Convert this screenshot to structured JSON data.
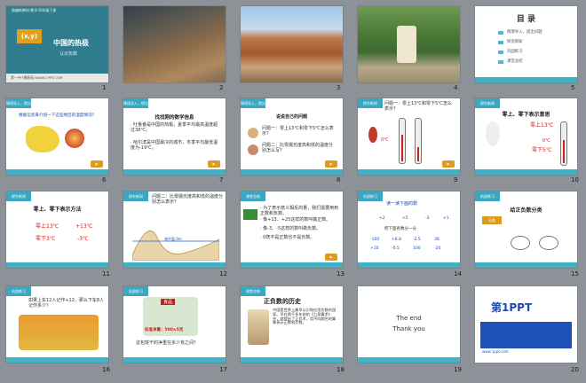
{
  "slides": [
    {
      "number": "1",
      "kicker": "统编新教材·数学·四年级下册",
      "badge": "(x,y)",
      "title": "中国的热极",
      "subtitle": "认识负数",
      "footer": "第一PPT模板网-WWW.1PPT.COM"
    },
    {
      "number": "2"
    },
    {
      "number": "3"
    },
    {
      "number": "4"
    },
    {
      "number": "5",
      "title": "目 录",
      "items": [
        "情境导入，提出问题",
        "探究新知",
        "巩固练习",
        "课堂总结"
      ]
    },
    {
      "number": "6",
      "tag": "情境导入，提出问题",
      "caption": "根据信息来介绍一下这些地区的温度情况？"
    },
    {
      "number": "7",
      "tag": "情境导入，提出问题",
      "title": "找找刚的数学信息",
      "lines": [
        "· 吐鲁番是中国的热极，夏季平均最高温度超过38℃。",
        "· 哈尔滨是中国最冷的城市，冬季平均最低温度为-19℃。"
      ]
    },
    {
      "number": "8",
      "tag": "情境导入，提出问题",
      "title": "说说自己的问题",
      "lines": [
        "问题一：零上13℃和零下5℃怎么表示？",
        "问题二：比零摄氏度高和低的温度分别怎么写？"
      ]
    },
    {
      "number": "9",
      "tag": "探究新知",
      "question": "问题一：零上13℃和零下5℃怎么表示？",
      "label": "0℃"
    },
    {
      "number": "10",
      "tag": "探究新知",
      "title": "零上、零下表示意思",
      "label1": "零上13℃",
      "label2": "0℃",
      "label3": "零下5℃"
    },
    {
      "number": "11",
      "tag": "探究新知",
      "title": "零上、零下表示方法",
      "line1a": "零上13℃",
      "line1b": "+13℃",
      "line2a": "零下3℃",
      "line2b": "-3℃"
    },
    {
      "number": "12",
      "tag": "探究新知",
      "question": "问题二：比零摄氏度高和低的温度分别怎么表示？",
      "annot": "海平面 0m"
    },
    {
      "number": "13",
      "tag": "课堂总结",
      "lines": [
        "· 为了表示意义相反的量，我们需要用到正数和负数。",
        "· 像+13、+25这样的数叫做正数。",
        "· 像-3、-5这样的数叫做负数。",
        "· 0既不是正数也不是负数。"
      ]
    },
    {
      "number": "14",
      "tag": "巩固练习",
      "title": "读一读下面的数",
      "values": [
        "+2",
        "+5",
        "-3",
        "+1",
        "-100",
        "+6.8",
        "-2.5",
        "38",
        "+10",
        "-0.5",
        "100",
        "-20"
      ],
      "sub": "把下面各数分一分"
    },
    {
      "number": "15",
      "tag": "巩固练习",
      "title": "给正负数分类",
      "box": "分类"
    },
    {
      "number": "16",
      "tag": "巩固练习",
      "caption": "如果上车12人记作+12，那么下车8人记作多少？"
    },
    {
      "number": "17",
      "tag": "巩固练习",
      "packlabel": "食品",
      "price": "标准净重：500±5克",
      "note": "这包饼干的净重在多少克之间？"
    },
    {
      "number": "18",
      "tag": "课堂总结",
      "title": "正负数的历史",
      "body": "中国是世界上最早认识和应用负数的国家。早在两千多年前的《九章算术》中，就提出了正负术，用不同颜色的算筹表示正数和负数。"
    },
    {
      "number": "19",
      "line1": "The end",
      "line2": "Thank you"
    },
    {
      "number": "20",
      "brand": "第1PPT",
      "url": "www.1ppt.com"
    }
  ],
  "colors": {
    "accent": "#3fb2c8",
    "gold": "#dc9c20",
    "canvas": "#8d9298"
  }
}
